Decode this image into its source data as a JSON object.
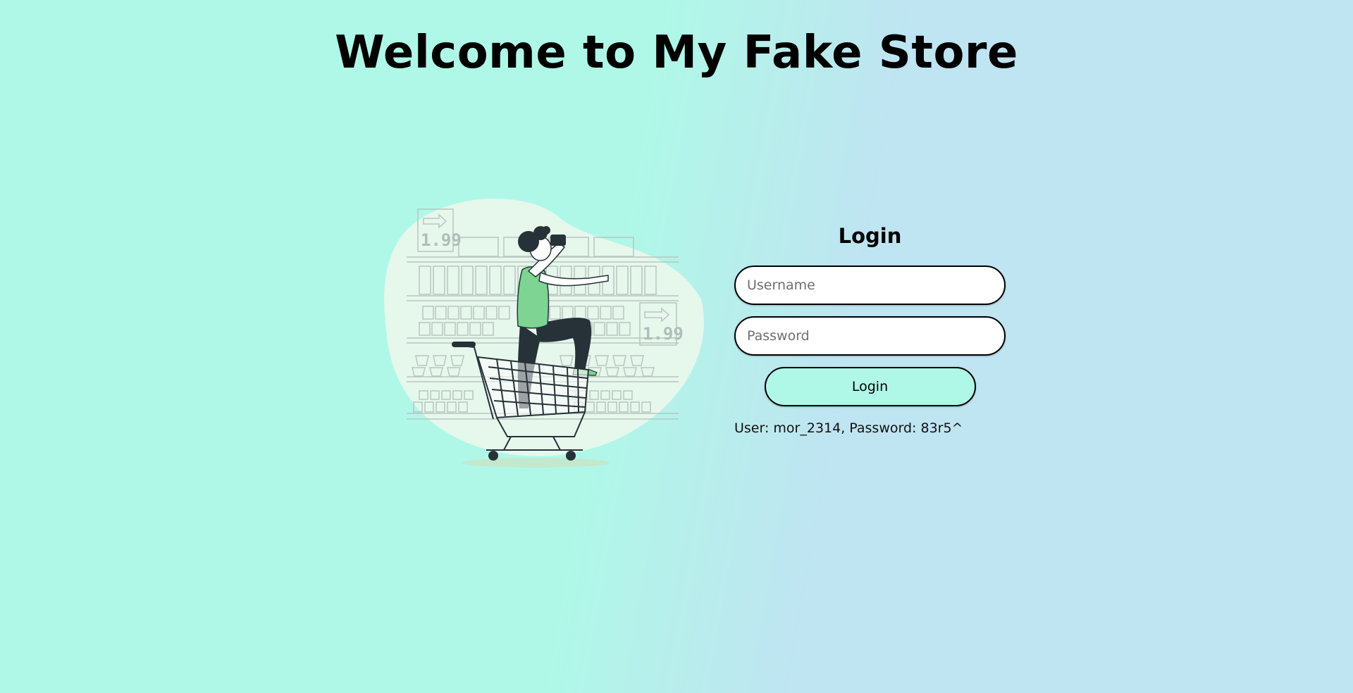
{
  "page": {
    "title": "Welcome to My Fake Store"
  },
  "illustration": {
    "price_tag_1": "1.99",
    "price_tag_2": "1.99",
    "icon": "shopping-cart-woman-illustration"
  },
  "login": {
    "heading": "Login",
    "username_placeholder": "Username",
    "username_value": "",
    "password_placeholder": "Password",
    "password_value": "",
    "button_label": "Login",
    "credentials_hint": "User: mor_2314, Password: 83r5^"
  },
  "colors": {
    "background_left": "#aff8e8",
    "background_right": "#bfe4f2",
    "button_fill": "#aff8e8",
    "blob": "#e6f7ec",
    "shirt": "#7ed492",
    "dark": "#263238"
  }
}
